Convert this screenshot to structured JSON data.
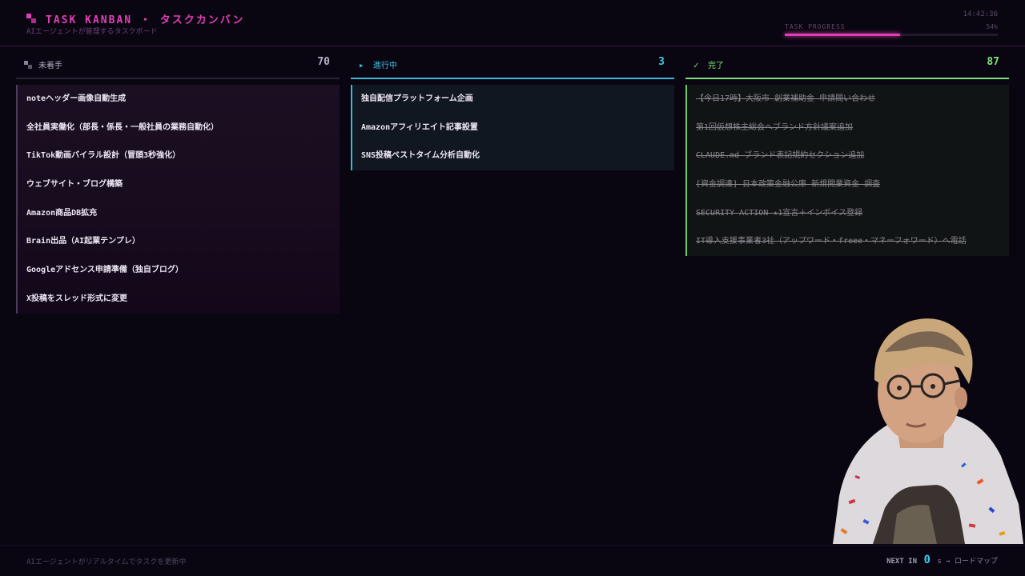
{
  "header": {
    "title": "TASK KANBAN ・ タスクカンバン",
    "subtitle": "AIエージェントが管理するタスクボード",
    "clock": "14:42:36",
    "progress_label": "TASK PROGRESS",
    "progress_text": "54%",
    "progress_value": 0.54
  },
  "columns": {
    "todo": {
      "label": "未着手",
      "count": "70",
      "icon": "pixel-block-icon",
      "cards": [
        "noteヘッダー画像自動生成",
        "全社員実働化（部長・係長・一般社員の業務自動化）",
        "TikTok動画バイラル設計（冒頭3秒強化）",
        "ウェブサイト・ブログ構築",
        "Amazon商品DB拡充",
        "Brain出品（AI起業テンプレ）",
        "Googleアドセンス申請準備（独自ブログ）",
        "X投稿をスレッド形式に変更"
      ]
    },
    "in_progress": {
      "label": "進行中",
      "count": "3",
      "icon": "play-icon",
      "icon_glyph": "▸",
      "cards": [
        "独自配信プラットフォーム企画",
        "Amazonアフィリエイト記事設置",
        "SNS投稿ベストタイム分析自動化"
      ]
    },
    "done": {
      "label": "完了",
      "count": "87",
      "icon": "check-icon",
      "icon_glyph": "✓",
      "cards": [
        "【今日17時】大阪市 創業補助金 申請問い合わせ",
        "第1回仮想株主総会へブランド方針議案追加",
        "CLAUDE.md ブランド表記規約セクション追加",
        "[資金調達] 日本政策金融公庫 新規開業資金 調査",
        "SECURITY ACTION ★1宣言＋インボイス登録",
        "IT導入支援事業者3社（アップワード・freee・マネーフォワード）へ電話"
      ]
    }
  },
  "footer": {
    "left": "AIエージェントがリアルタイムでタスクを更新中",
    "next_label": "NEXT IN",
    "next_num": "0",
    "next_suffix": "s → ロードマップ"
  },
  "colors": {
    "accent": "#e23fb5",
    "in_progress": "#3fc7e6",
    "done": "#7ee07a",
    "background": "#0a0611"
  }
}
